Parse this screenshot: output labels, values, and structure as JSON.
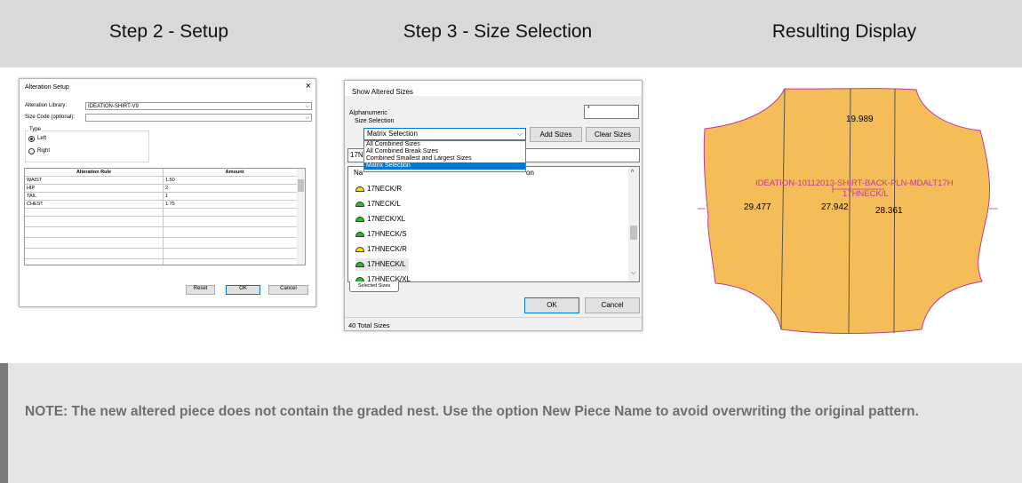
{
  "headers": {
    "step2": "Step 2 - Setup",
    "step3": "Step 3 - Size Selection",
    "result": "Resulting Display"
  },
  "alteration_setup": {
    "title": "Alteration Setup",
    "close": "×",
    "library_label": "Alteration Library:",
    "library_value": "IDEATION-SHIRT-V9",
    "size_code_label": "Size Code (optional):",
    "size_code_value": "",
    "type_label": "Type",
    "type_options": [
      {
        "label": "Left",
        "selected": true
      },
      {
        "label": "Right",
        "selected": false
      }
    ],
    "table_headers": [
      "Alteration Rule",
      "Amount"
    ],
    "rows": [
      {
        "rule": "WAIST",
        "amount": "1.50"
      },
      {
        "rule": "HIP",
        "amount": "2"
      },
      {
        "rule": "TAIL",
        "amount": "1"
      },
      {
        "rule": "CHEST",
        "amount": "1.75"
      }
    ],
    "buttons": {
      "reset": "Reset",
      "ok": "OK",
      "cancel": "Cancel"
    }
  },
  "show_altered_sizes": {
    "title": "Show Altered Sizes",
    "alphanumeric_label": "Alphanumeric",
    "alphanumeric_value": "*",
    "size_selection_label": "Size Selection",
    "combo_value": "Matrix Selection",
    "add_sizes": "Add Sizes",
    "clear_sizes": "Clear Sizes",
    "dropdown_options": [
      {
        "label": "All Combined Sizes",
        "selected": false
      },
      {
        "label": "All Combined Break Sizes",
        "selected": false
      },
      {
        "label": "Combined Smallest and Largest Sizes",
        "selected": false
      },
      {
        "label": "Matrix Selection",
        "selected": true
      }
    ],
    "input_partial": "17N",
    "list_header_left": "Na",
    "list_header_right": "on",
    "sizes": [
      {
        "label": "17NECK/R",
        "color": "#f2e200"
      },
      {
        "label": "17NECK/L",
        "color": "#1fc21f"
      },
      {
        "label": "17NECK/XL",
        "color": "#1fc21f"
      },
      {
        "label": "17HNECK/S",
        "color": "#1fc21f"
      },
      {
        "label": "17HNECK/R",
        "color": "#f2e200"
      },
      {
        "label": "17HNECK/L",
        "color": "#1fc21f"
      },
      {
        "label": "17HNECK/XL",
        "color": "#1fc21f"
      }
    ],
    "tab_label": "Selected Sizes",
    "ok": "OK",
    "cancel": "Cancel",
    "status": "40 Total Sizes"
  },
  "result": {
    "top_value": "19.989",
    "piece_name": "IDEATION-10112013-SHIRT-BACK-PLN-MDALT17H",
    "size_name": "17HNECK/L",
    "left_value": "29.477",
    "mid_value": "27.942",
    "right_value": "28.361",
    "fill_color": "#f5bd57",
    "line_color": "#c0399a"
  },
  "note": "NOTE: The new altered piece does not contain the graded nest. Use the option New Piece Name to avoid overwriting the original pattern."
}
